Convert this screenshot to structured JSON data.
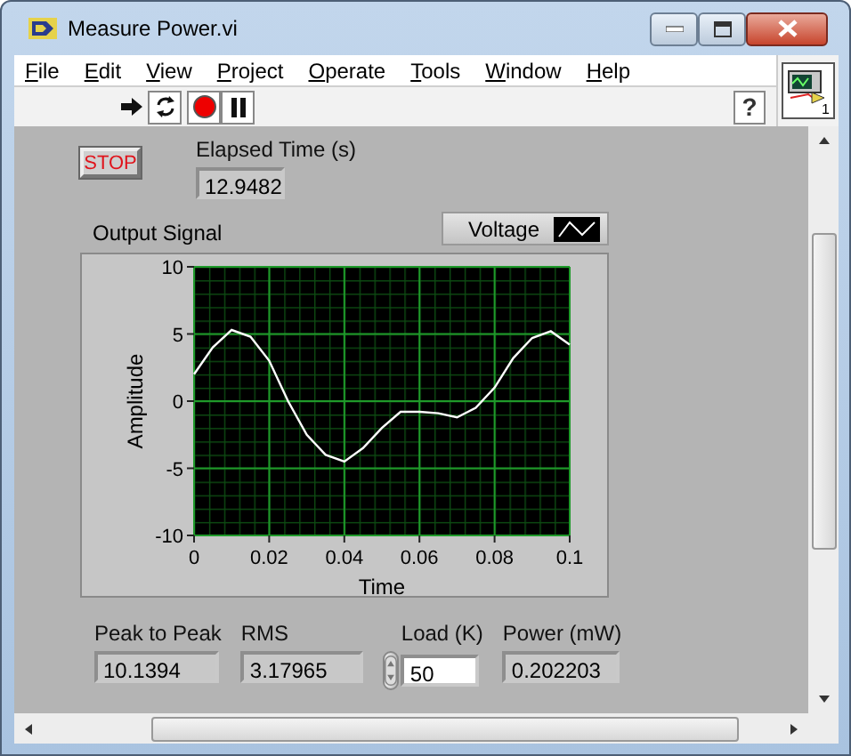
{
  "window": {
    "title": "Measure Power.vi"
  },
  "menu": [
    {
      "label": "File"
    },
    {
      "label": "Edit"
    },
    {
      "label": "View"
    },
    {
      "label": "Project"
    },
    {
      "label": "Operate"
    },
    {
      "label": "Tools"
    },
    {
      "label": "Window"
    },
    {
      "label": "Help"
    }
  ],
  "toolbar": {
    "help": "?"
  },
  "connector_pane": {
    "label": "1"
  },
  "stop_button": {
    "label": "STOP"
  },
  "elapsed_time": {
    "label": "Elapsed Time (s)",
    "value": "12.9482"
  },
  "graph": {
    "label": "Output Signal",
    "chart_data": {
      "type": "line",
      "xlabel": "Time",
      "ylabel": "Amplitude",
      "x": [
        0,
        0.005,
        0.01,
        0.015,
        0.02,
        0.025,
        0.03,
        0.035,
        0.04,
        0.045,
        0.05,
        0.055,
        0.06,
        0.065,
        0.07,
        0.075,
        0.08,
        0.085,
        0.09,
        0.095,
        0.1
      ],
      "series": [
        {
          "name": "Voltage",
          "color": "#ffffff",
          "values": [
            2,
            4,
            5.3,
            4.8,
            3,
            0,
            -2.5,
            -4,
            -4.5,
            -3.5,
            -2,
            -0.8,
            -0.8,
            -0.9,
            -1.2,
            -0.5,
            1,
            3.2,
            4.7,
            5.2,
            4.2
          ]
        }
      ],
      "grid": true,
      "xlim": [
        0,
        0.1
      ],
      "ylim": [
        -10,
        10
      ],
      "xticks": [
        0,
        0.02,
        0.04,
        0.06,
        0.08,
        0.1
      ],
      "yticks": [
        -10,
        -5,
        0,
        5,
        10
      ]
    }
  },
  "readouts": [
    {
      "kind": "indicator",
      "label": "Peak to Peak",
      "value": "10.1394"
    },
    {
      "kind": "indicator",
      "label": "RMS",
      "value": "3.17965"
    },
    {
      "kind": "control",
      "label": "Load (K)",
      "value": "50"
    },
    {
      "kind": "indicator",
      "label": "Power (mW)",
      "value": "0.202203"
    }
  ]
}
